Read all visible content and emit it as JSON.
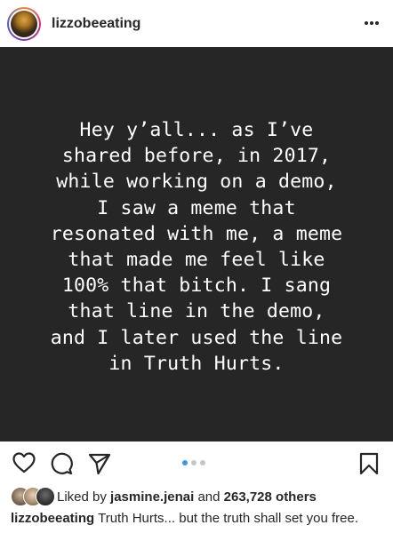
{
  "header": {
    "username": "lizzobeeating",
    "avatar": "profile-avatar",
    "more_icon": "more-horizontal-icon"
  },
  "post": {
    "text_lines": [
      "Hey y’all... as I’ve",
      "shared before, in 2017,",
      "while working on a demo,",
      "I saw a meme that",
      "resonated with me, a meme",
      "that made me feel like",
      "100% that bitch. I sang",
      "that line in the demo,",
      "and I later used the line",
      "in Truth Hurts."
    ],
    "background_color": "#262626"
  },
  "actions": {
    "like_icon": "heart-icon",
    "comment_icon": "comment-icon",
    "share_icon": "send-icon",
    "save_icon": "bookmark-icon",
    "carousel": {
      "count": 3,
      "active_index": 0
    }
  },
  "likes": {
    "prefix": "Liked by",
    "top_liker": "jasmine.jenai",
    "connector": "and",
    "others_count": "263,728 others"
  },
  "caption": {
    "username": "lizzobeeating",
    "text": "Truth Hurts... but the truth shall set you free."
  }
}
